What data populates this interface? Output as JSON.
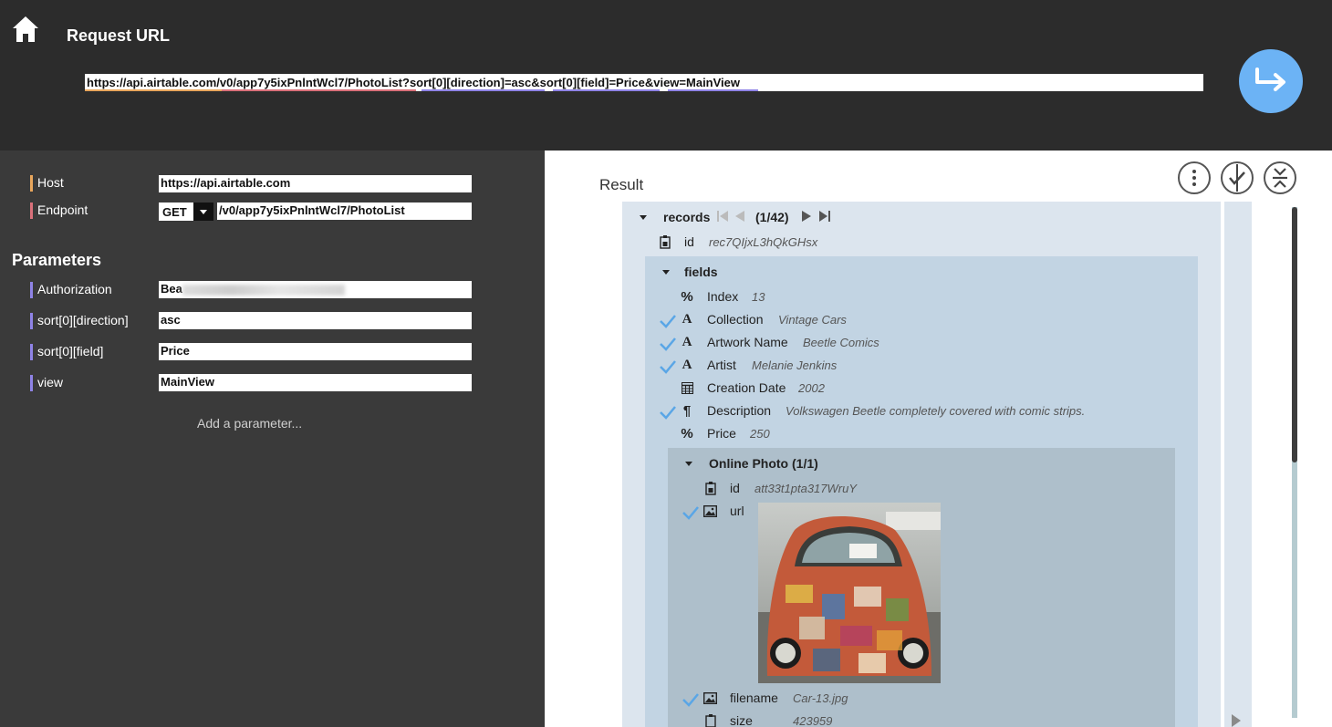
{
  "header": {
    "title": "Request URL",
    "url": "https://api.airtable.com/v0/app7y5ixPnlntWcl7/PhotoList?sort[0][direction]=asc&sort[0][field]=Price&view=MainView"
  },
  "colors": {
    "host": "#e8a65c",
    "endpoint": "#d9707a",
    "param": "#8f83e6",
    "go_button": "#6cb3f5",
    "check": "#5aa6e6"
  },
  "request": {
    "host_label": "Host",
    "host_value": "https://api.airtable.com",
    "endpoint_label": "Endpoint",
    "method": "GET",
    "endpoint_value": "/v0/app7y5ixPnlntWcl7/PhotoList"
  },
  "parameters": {
    "heading": "Parameters",
    "items": [
      {
        "label": "Authorization",
        "value": "Bea"
      },
      {
        "label": "sort[0][direction]",
        "value": "asc"
      },
      {
        "label": "sort[0][field]",
        "value": "Price"
      },
      {
        "label": "view",
        "value": "MainView"
      }
    ],
    "add_label": "Add a parameter..."
  },
  "result": {
    "title": "Result",
    "records_label": "records",
    "records_page": "(1/42)",
    "record_id_key": "id",
    "record_id_value": "rec7QIjxL3hQkGHsx",
    "fields_label": "fields",
    "fields": [
      {
        "icon": "%",
        "key": "Index",
        "value": "13",
        "checked": false
      },
      {
        "icon": "A",
        "key": "Collection",
        "value": "Vintage Cars",
        "checked": true
      },
      {
        "icon": "A",
        "key": "Artwork Name",
        "value": "Beetle Comics",
        "checked": true
      },
      {
        "icon": "A",
        "key": "Artist",
        "value": "Melanie Jenkins",
        "checked": true
      },
      {
        "icon": "calendar",
        "key": "Creation Date",
        "value": "2002",
        "checked": false
      },
      {
        "icon": "¶",
        "key": "Description",
        "value": "Volkswagen Beetle completely covered with comic strips.",
        "checked": true
      },
      {
        "icon": "%",
        "key": "Price",
        "value": "250",
        "checked": false
      }
    ],
    "photo": {
      "label": "Online Photo (1/1)",
      "id_key": "id",
      "id_value": "att33t1pta317WruY",
      "url_key": "url",
      "filename_key": "filename",
      "filename_value": "Car-13.jpg",
      "size_key": "size",
      "size_value": "423959"
    }
  }
}
